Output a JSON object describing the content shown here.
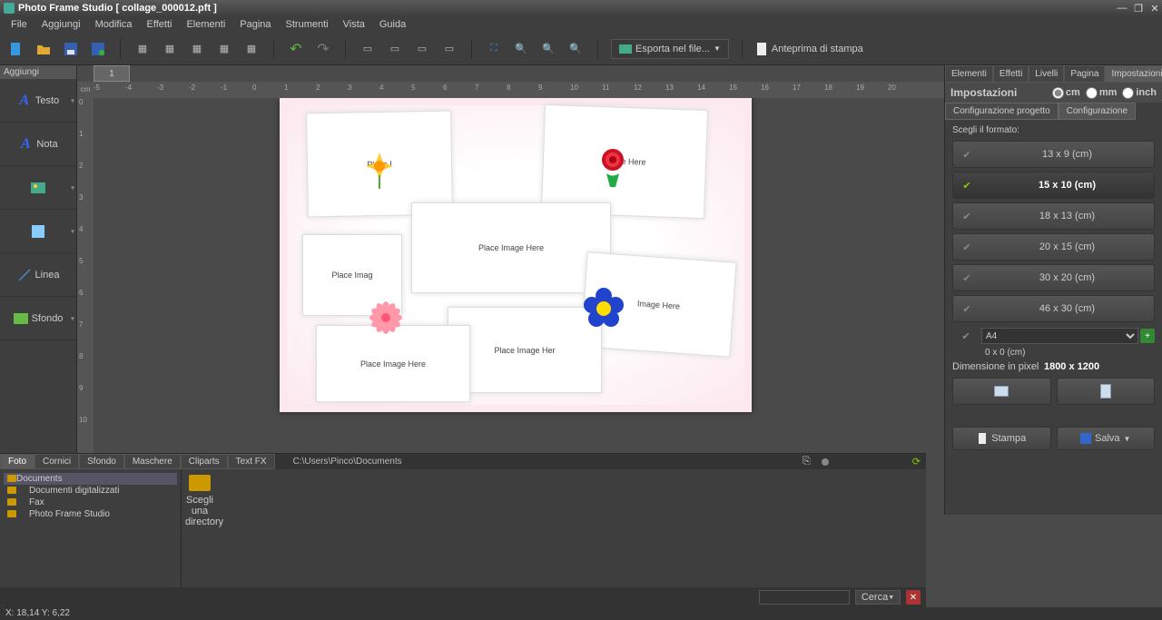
{
  "title": "Photo Frame Studio [ collage_000012.pft ]",
  "menu": [
    "File",
    "Aggiungi",
    "Modifica",
    "Effetti",
    "Elementi",
    "Pagina",
    "Strumenti",
    "Vista",
    "Guida"
  ],
  "toolbar": {
    "export": "Esporta nel file...",
    "preview": "Anteprima di stampa"
  },
  "left": {
    "header": "Aggiungi",
    "items": [
      {
        "label": "Testo",
        "icon": "A"
      },
      {
        "label": "Nota",
        "icon": "A"
      },
      {
        "label": "",
        "icon": "img"
      },
      {
        "label": "",
        "icon": "rect"
      },
      {
        "label": "Linea",
        "icon": "line"
      },
      {
        "label": "Sfondo",
        "icon": "bg"
      }
    ]
  },
  "doc_tab": "1",
  "ruler_unit": "cm",
  "placeholders": {
    "p1": "Place I",
    "p2": "Image Here",
    "p3": "Place Image Here",
    "p4": "Place Imag",
    "p5": "Image Here",
    "p6": "Place Image Her",
    "p7": "Place Image Here"
  },
  "right": {
    "tabs": [
      "Elementi",
      "Effetti",
      "Livelli",
      "Pagina",
      "Impostazioni"
    ],
    "active_tab": "Impostazioni",
    "title": "Impostazioni",
    "units": [
      "cm",
      "mm",
      "inch"
    ],
    "unit_selected": "cm",
    "subtabs": [
      "Configurazione progetto",
      "Configurazione"
    ],
    "choose_format": "Scegli il formato:",
    "formats": [
      {
        "label": "13 x 9 (cm)",
        "sel": false
      },
      {
        "label": "15 x 10 (cm)",
        "sel": true
      },
      {
        "label": "18 x 13 (cm)",
        "sel": false
      },
      {
        "label": "20 x 15 (cm)",
        "sel": false
      },
      {
        "label": "30 x 20 (cm)",
        "sel": false
      },
      {
        "label": "46 x 30 (cm)",
        "sel": false
      }
    ],
    "custom_select": "A4",
    "custom_size": "0 x 0 (cm)",
    "pixel_dim_label": "Dimensione in pixel",
    "pixel_dim_value": "1800 x 1200",
    "print": "Stampa",
    "save": "Salva"
  },
  "browser": {
    "tabs": [
      "Foto",
      "Cornici",
      "Sfondo",
      "Maschere",
      "Cliparts",
      "Text FX"
    ],
    "active": "Foto",
    "path": "C:\\Users\\Pinco\\Documents",
    "dir_action": "Scegli una directory",
    "tree": [
      "Documents",
      "Documenti digitalizzati",
      "Fax",
      "Photo Frame Studio"
    ],
    "search": "Cerca"
  },
  "status": "X: 18,14 Y: 6,22"
}
